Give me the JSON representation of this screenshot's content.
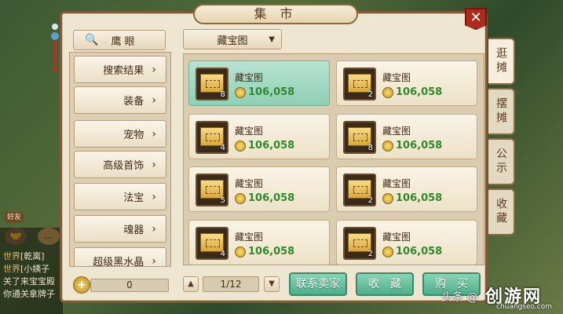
{
  "window": {
    "title": "集 市"
  },
  "side_tabs": [
    {
      "label": "逛摊",
      "active": true
    },
    {
      "label": "摆摊",
      "active": false
    },
    {
      "label": "公示",
      "active": false
    },
    {
      "label": "收藏",
      "active": false
    }
  ],
  "search": {
    "label": "鹰 眼"
  },
  "categories": [
    {
      "label": "搜索结果"
    },
    {
      "label": "装备"
    },
    {
      "label": "宠物"
    },
    {
      "label": "高级首饰"
    },
    {
      "label": "法宝"
    },
    {
      "label": "魂器"
    },
    {
      "label": "超级黑水晶"
    }
  ],
  "filter": {
    "selected": "藏宝图"
  },
  "items": [
    {
      "name": "藏宝图",
      "price": "106,058",
      "count": "8",
      "selected": true
    },
    {
      "name": "藏宝图",
      "price": "106,058",
      "count": "2",
      "selected": false
    },
    {
      "name": "藏宝图",
      "price": "106,058",
      "count": "4",
      "selected": false
    },
    {
      "name": "藏宝图",
      "price": "106,058",
      "count": "8",
      "selected": false
    },
    {
      "name": "藏宝图",
      "price": "106,058",
      "count": "5",
      "selected": false
    },
    {
      "name": "藏宝图",
      "price": "106,058",
      "count": "2",
      "selected": false
    },
    {
      "name": "藏宝图",
      "price": "106,058",
      "count": "4",
      "selected": false
    },
    {
      "name": "藏宝图",
      "price": "106,058",
      "count": "2",
      "selected": false
    }
  ],
  "currency": {
    "value": "0"
  },
  "pagination": {
    "text": "1/12"
  },
  "actions": {
    "contact": "联系卖家",
    "favorite": "收　藏",
    "buy": "购　买"
  },
  "background": {
    "friend_label": "好友",
    "chat": [
      {
        "tag": "世界",
        "text": "[乾离]"
      },
      {
        "tag": "世界",
        "text": "[小姨子"
      },
      {
        "tag": "",
        "text": "关了来宝宝殿"
      },
      {
        "tag": "",
        "text": "你通关拿牌子"
      }
    ]
  },
  "watermark": {
    "left": "头条 @",
    "right": "创游网",
    "domain": "chuangseo.com"
  }
}
